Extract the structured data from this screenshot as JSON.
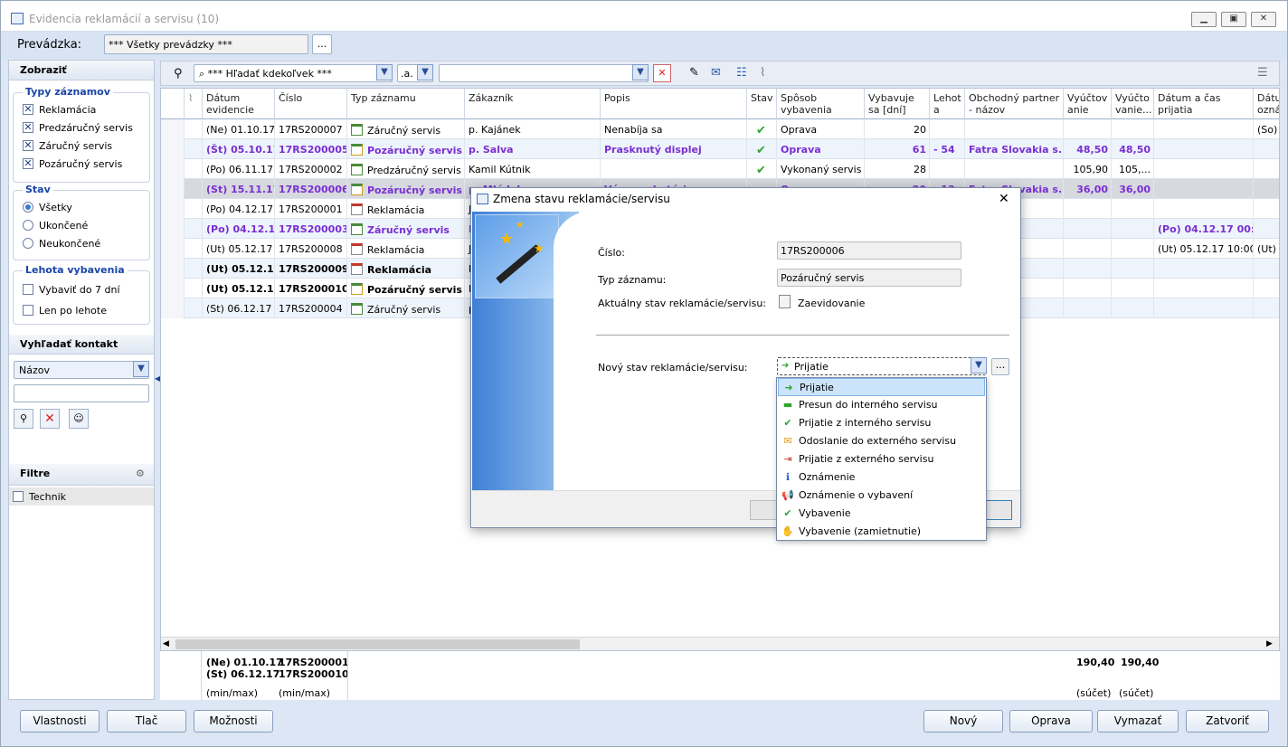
{
  "window": {
    "title": "Evidencia reklamácií a servisu (10)"
  },
  "top": {
    "label": "Prevádzka:",
    "value": "*** Všetky prevádzky ***",
    "browse": "..."
  },
  "left": {
    "show_header": "Zobraziť",
    "types_title": "Typy záznamov",
    "types": [
      "Reklamácia",
      "Predzáručný servis",
      "Záručný servis",
      "Pozáručný servis"
    ],
    "state_title": "Stav",
    "states": [
      "Všetky",
      "Ukončené",
      "Neukončené"
    ],
    "deadline_title": "Lehota vybavenia",
    "deadlines": [
      "Vybaviť do 7 dní",
      "Len po lehote"
    ],
    "contact_header": "Vyhľadať kontakt",
    "contact_select": "Názov",
    "filters_header": "Filtre",
    "filters": [
      "Technik"
    ]
  },
  "toolbar": {
    "search_select": "*** Hľadať kdekoľvek ***",
    "mode_select": ".a."
  },
  "columns": [
    "Dátum evidencie",
    "Číslo",
    "Typ záznamu",
    "Zákazník",
    "Popis",
    "Stav",
    "Spôsob vybavenia",
    "Vybavuje sa [dní]",
    "Lehot a vy...",
    "Obchodný partner - názov",
    "Vyúčtov anie",
    "Vyúčto vanie...",
    "Dátum a čas prijatia",
    "Dátu ozná"
  ],
  "rows": [
    {
      "date": "(Ne) 01.10.17",
      "num": "17RS200007",
      "type": "Záručný servis",
      "cust": "p. Kajánek",
      "desc": "Nenabíja sa",
      "state": "ok",
      "method": "Oprava",
      "days": "20",
      "lehota": "",
      "partner": "",
      "v1": "",
      "v2": "",
      "recv": "",
      "last": "(So) 2",
      "style": "normal"
    },
    {
      "date": "(Št) 05.10.17",
      "num": "17RS200005",
      "type": "Pozáručný servis",
      "cust": "p. Salva",
      "desc": "Prasknutý displej",
      "state": "ok",
      "method": "Oprava",
      "days": "61",
      "lehota": "- 54",
      "partner": "Fatra Slovakia s.r.o",
      "v1": "48,50",
      "v2": "48,50",
      "recv": "",
      "last": "",
      "style": "purple"
    },
    {
      "date": "(Po) 06.11.17",
      "num": "17RS200002",
      "type": "Predzáručný servis",
      "cust": "Kamil Kútnik",
      "desc": "",
      "state": "ok",
      "method": "Vykonaný servis",
      "days": "28",
      "lehota": "",
      "partner": "",
      "v1": "105,90",
      "v2": "105,...",
      "recv": "",
      "last": "",
      "style": "normal"
    },
    {
      "date": "(St) 15.11.17",
      "num": "17RS200006",
      "type": "Pozáručný servis",
      "cust": "p. Mládek",
      "desc": "Výmena batérie",
      "state": "",
      "method": "Oprava",
      "days": "20",
      "lehota": "- 13",
      "partner": "Fatra Slovakia s.r.o",
      "v1": "36,00",
      "v2": "36,00",
      "recv": "",
      "last": "",
      "style": "purple-sel"
    },
    {
      "date": "(Po) 04.12.17",
      "num": "17RS200001",
      "type": "Reklamácia",
      "cust": "J",
      "desc": "",
      "state": "",
      "method": "",
      "days": "",
      "lehota": "",
      "partner": ".o",
      "v1": "",
      "v2": "",
      "recv": "",
      "last": "",
      "style": "normal"
    },
    {
      "date": "(Po) 04.12.17",
      "num": "17RS200003",
      "type": "Záručný servis",
      "cust": "F",
      "desc": "",
      "state": "",
      "method": "",
      "days": "",
      "lehota": "",
      "partner": "",
      "v1": "",
      "v2": "",
      "recv": "(Po) 04.12.17 00:00",
      "last": "",
      "style": "purple"
    },
    {
      "date": "(Ut) 05.12.17",
      "num": "17RS200008",
      "type": "Reklamácia",
      "cust": "J",
      "desc": "",
      "state": "",
      "method": "",
      "days": "",
      "lehota": "",
      "partner": "",
      "v1": "",
      "v2": "",
      "recv": "(Ut) 05.12.17 10:00",
      "last": "(Ut) 1",
      "style": "normal"
    },
    {
      "date": "(Ut) 05.12.17",
      "num": "17RS200009",
      "type": "Reklamácia",
      "cust": "F",
      "desc": "",
      "state": "",
      "method": "",
      "days": "",
      "lehota": "",
      "partner": "",
      "v1": "",
      "v2": "",
      "recv": "",
      "last": "",
      "style": "bold"
    },
    {
      "date": "(Ut) 05.12.17",
      "num": "17RS200010",
      "type": "Pozáručný servis",
      "cust": "E",
      "desc": "",
      "state": "",
      "method": "",
      "days": "",
      "lehota": "",
      "partner": "",
      "v1": "",
      "v2": "",
      "recv": "",
      "last": "",
      "style": "bold"
    },
    {
      "date": "(St) 06.12.17",
      "num": "17RS200004",
      "type": "Záručný servis",
      "cust": "p",
      "desc": "",
      "state": "",
      "method": "",
      "days": "",
      "lehota": "",
      "partner": "",
      "v1": "",
      "v2": "",
      "recv": "",
      "last": "",
      "style": "normal"
    }
  ],
  "footer": {
    "date_min": "(Ne) 01.10.17",
    "date_max": "(St) 06.12.17",
    "num_min": "17RS200001",
    "num_max": "17RS200010",
    "minmax": "(min/max)",
    "sum1": "190,40",
    "sum2": "190,40",
    "sum_label": "(súčet)"
  },
  "buttons": {
    "props": "Vlastnosti",
    "print": "Tlač",
    "options": "Možnosti",
    "new": "Nový",
    "edit": "Oprava",
    "delete": "Vymazať",
    "close": "Zatvoriť"
  },
  "dialog": {
    "title": "Zmena stavu reklamácie/servisu",
    "num_label": "Číslo:",
    "num_value": "17RS200006",
    "type_label": "Typ záznamu:",
    "type_value": "Pozáručný servis",
    "current_label": "Aktuálny stav reklamácie/servisu:",
    "current_value": "Zaevidovanie",
    "new_label": "Nový stav reklamácie/servisu:",
    "new_value": "Prijatie",
    "browse": "...",
    "options": [
      "Prijatie",
      "Presun do interného servisu",
      "Prijatie z interného servisu",
      "Odoslanie do externého servisu",
      "Prijatie z externého servisu",
      "Oznámenie",
      "Oznámenie o vybavení",
      "Vybavenie",
      "Vybavenie (zamietnutie)"
    ],
    "option_icons": [
      "prijatie-icon",
      "presun-icon",
      "prijatie-interny-icon",
      "envelope-icon",
      "prijatie-externy-icon",
      "info-icon",
      "megaphone-icon",
      "check-icon",
      "stop-hand-icon"
    ]
  }
}
